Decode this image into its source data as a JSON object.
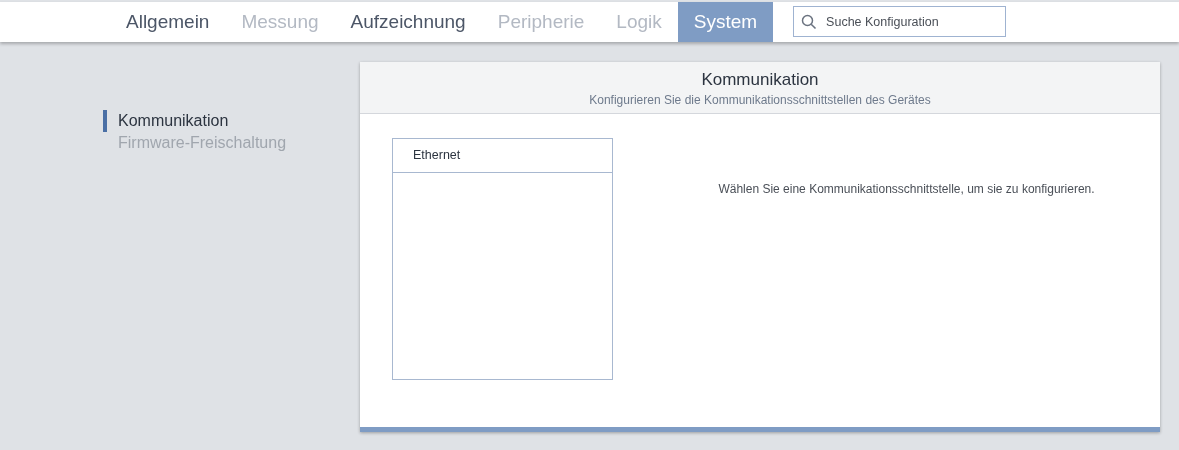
{
  "tabs": [
    {
      "label": "Allgemein",
      "selected": false,
      "disabled": false
    },
    {
      "label": "Messung",
      "selected": false,
      "disabled": true
    },
    {
      "label": "Aufzeichnung",
      "selected": false,
      "disabled": false
    },
    {
      "label": "Peripherie",
      "selected": false,
      "disabled": true
    },
    {
      "label": "Logik",
      "selected": false,
      "disabled": true
    },
    {
      "label": "System",
      "selected": true,
      "disabled": false
    }
  ],
  "search": {
    "placeholder": "Suche Konfiguration"
  },
  "sidebar": {
    "items": [
      {
        "label": "Kommunikation",
        "selected": true
      },
      {
        "label": "Firmware-Freischaltung",
        "selected": false
      }
    ]
  },
  "panel": {
    "title": "Kommunikation",
    "subtitle": "Konfigurieren Sie die Kommunikationsschnittstellen des Gerätes",
    "interfaces": [
      {
        "label": "Ethernet"
      }
    ],
    "message": "Wählen Sie eine Kommunikationsschnittstelle, um sie zu konfigurieren."
  }
}
